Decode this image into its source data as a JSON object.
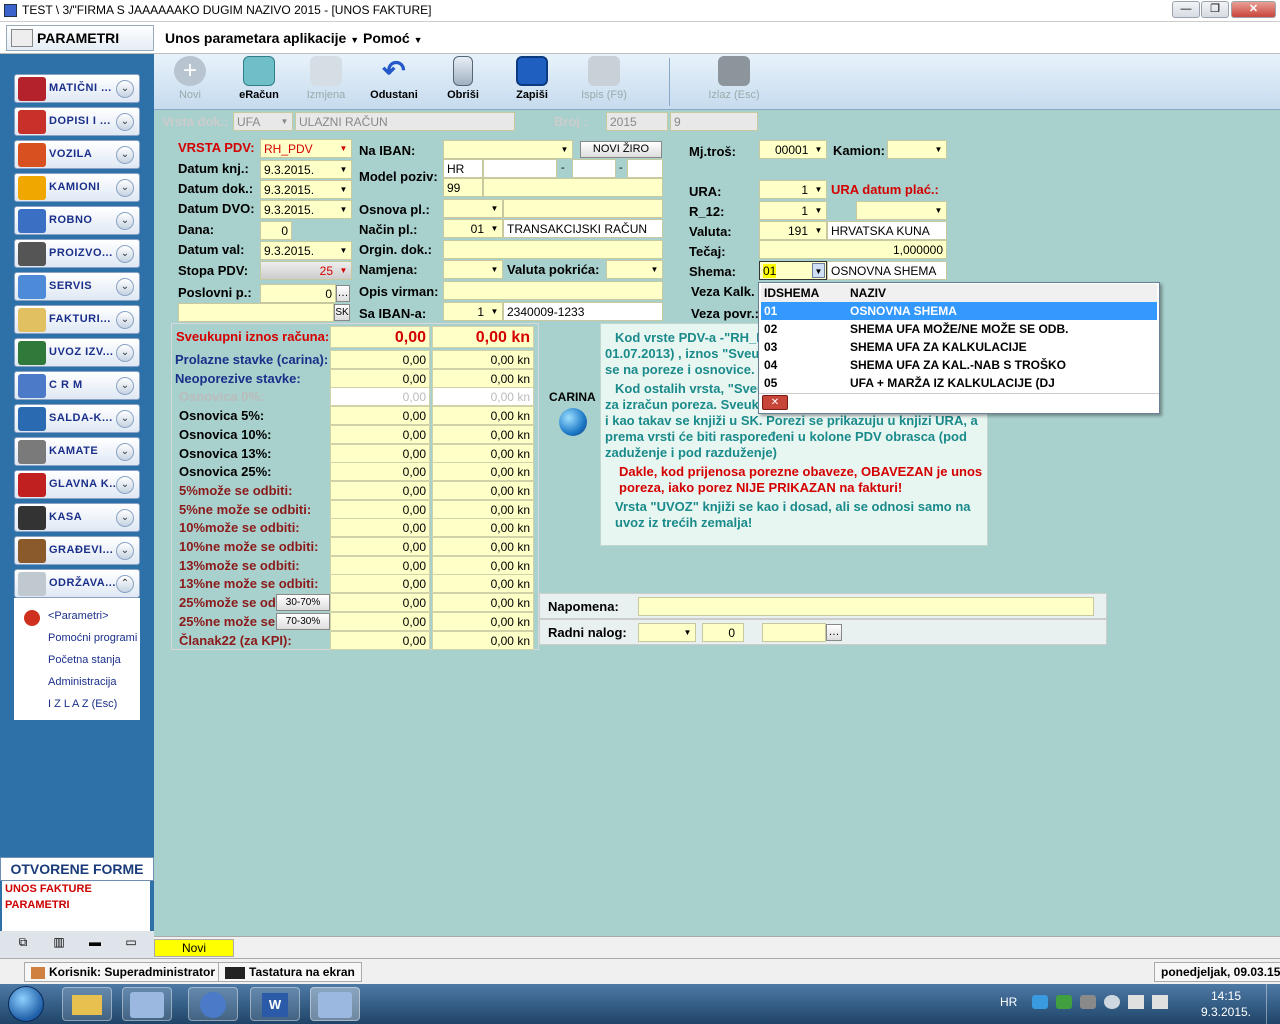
{
  "window": {
    "title": "TEST \\ 3/\"FIRMA S JAAAAAAKO DUGIM NAZIVO  2015 - [UNOS FAKTURE]",
    "min": "—",
    "max": "❐",
    "close": "✕"
  },
  "menubar": {
    "parametri": "PARAMETRI",
    "unos": "Unos parametara aplikacije",
    "pomoc": "Pomoć"
  },
  "sidebar": {
    "items": [
      {
        "label": "MATIČNI ...",
        "color": "#b4232b"
      },
      {
        "label": "DOPISI I ...",
        "color": "#c8302a"
      },
      {
        "label": "VOZILA",
        "color": "#d85020"
      },
      {
        "label": "KAMIONI",
        "color": "#f0a800"
      },
      {
        "label": "ROBNO",
        "color": "#3b6fc4"
      },
      {
        "label": "PROIZVO...",
        "color": "#555555"
      },
      {
        "label": "SERVIS",
        "color": "#4d8ad8"
      },
      {
        "label": "FAKTURI...",
        "color": "#e0c060"
      },
      {
        "label": "UVOZ IZV...",
        "color": "#2f7a3a"
      },
      {
        "label": "C R M",
        "color": "#4d7ac8"
      },
      {
        "label": "SALDA-K...",
        "color": "#2a6ab0"
      },
      {
        "label": "KAMATE",
        "color": "#7a7a7a"
      },
      {
        "label": "GLAVNA K...",
        "color": "#c02020"
      },
      {
        "label": "KASA",
        "color": "#333333"
      },
      {
        "label": "GRAĐEVI...",
        "color": "#8a5a2a"
      },
      {
        "label": "ODRŽAVA...",
        "color": "#c0c8d0"
      }
    ],
    "submenu": [
      "<Parametri>",
      "Pomoćni programi",
      "Početna stanja",
      "Administracija",
      "I Z L A Z (Esc)"
    ],
    "open_forms_title": "OTVORENE FORME",
    "open_forms": [
      "UNOS FAKTURE",
      "PARAMETRI"
    ]
  },
  "toolbar": {
    "novi": "Novi",
    "eracun": "eRačun",
    "izmjena": "Izmjena",
    "odustani": "Odustani",
    "obrisi": "Obriši",
    "zapisi": "Zapiši",
    "ispis": "Ispis (F9)",
    "izlaz": "Izlaz (Esc)"
  },
  "header": {
    "vrsta_dok_label": "Vrsta dok.:",
    "vrsta_dok_code": "UFA",
    "vrsta_dok_name": "ULAZNI RAČUN",
    "broj_label": "Broj :",
    "broj_year": "2015",
    "broj_num": "9"
  },
  "form": {
    "vrsta_pdv_label": "VRSTA PDV:",
    "vrsta_pdv": "RH_PDV",
    "datum_knj_label": "Datum knj.:",
    "datum_knj": "9.3.2015.",
    "datum_dok_label": "Datum dok.:",
    "datum_dok": "9.3.2015.",
    "datum_dvo_label": "Datum DVO:",
    "datum_dvo": "9.3.2015.",
    "dana_label": "Dana:",
    "dana": "0",
    "datum_val_label": "Datum val:",
    "datum_val": "9.3.2015.",
    "stopa_pdv_label": "Stopa PDV:",
    "stopa_pdv": "25",
    "poslovni_p_label": "Poslovni p.:",
    "poslovni_p": "0",
    "sk": "SK",
    "na_iban_label": "Na IBAN:",
    "novi_ziro": "NOVI ŽIRO",
    "model_poziv_label": "Model poziv:",
    "model_hr": "HR",
    "model_99": "99",
    "osnova_pl_label": "Osnova pl.:",
    "nacin_pl_label": "Način pl.:",
    "nacin_pl_code": "01",
    "nacin_pl_name": "TRANSAKCIJSKI RAČUN",
    "orgin_dok_label": "Orgin. dok.:",
    "namjena_label": "Namjena:",
    "valuta_pokrica_label": "Valuta pokrića:",
    "opis_virman_label": "Opis virman:",
    "sa_iban_label": "Sa IBAN-a:",
    "sa_iban_code": "1",
    "sa_iban_value": "2340009-1233",
    "mj_tros_label": "Mj.troš:",
    "mj_tros": "00001",
    "kamion_label": "Kamion:",
    "ura_label": "URA:",
    "ura": "1",
    "ura_datum_label": "URA datum plać.:",
    "r12_label": "R_12:",
    "r12": "1",
    "valuta_label": "Valuta:",
    "valuta_code": "191",
    "valuta_name": "HRVATSKA KUNA",
    "tecaj_label": "Tečaj:",
    "tecaj": "1,000000",
    "shema_label": "Shema:",
    "shema_code": "01",
    "shema_name": "OSNOVNA SHEMA",
    "veza_kalk_label": "Veza Kalk.",
    "veza_povr_label": "Veza povr.:"
  },
  "shema_popup": {
    "col1": "IDSHEMA",
    "col2": "NAZIV",
    "rows": [
      {
        "id": "01",
        "name": "OSNOVNA SHEMA"
      },
      {
        "id": "02",
        "name": "SHEMA UFA MOŽE/NE MOŽE SE ODB."
      },
      {
        "id": "03",
        "name": "SHEMA UFA ZA KALKULACIJE"
      },
      {
        "id": "04",
        "name": "SHEMA UFA ZA KAL.-NAB S TROŠKO"
      },
      {
        "id": "05",
        "name": "UFA + MARŽA IZ KALKULACIJE (DJ"
      }
    ],
    "close": "✕"
  },
  "totals": {
    "header_label": "Sveukupni iznos računa:",
    "header_v1": "0,00",
    "header_v2": "0,00 kn",
    "rows": [
      {
        "label": "Prolazne stavke (carina):",
        "v1": "0,00",
        "v2": "0,00 kn",
        "style": "blue"
      },
      {
        "label": "Neoporezive stavke:",
        "v1": "0,00",
        "v2": "0,00 kn",
        "style": "blue"
      },
      {
        "label": "Osnovica 0%:",
        "v1": "0,00",
        "v2": "0,00 kn",
        "style": "gray"
      },
      {
        "label": "Osnovica 5%:",
        "v1": "0,00",
        "v2": "0,00 kn",
        "style": "black"
      },
      {
        "label": "Osnovica 10%:",
        "v1": "0,00",
        "v2": "0,00 kn",
        "style": "black"
      },
      {
        "label": "Osnovica 13%:",
        "v1": "0,00",
        "v2": "0,00 kn",
        "style": "black"
      },
      {
        "label": "Osnovica 25%:",
        "v1": "0,00",
        "v2": "0,00 kn",
        "style": "black"
      },
      {
        "label": "5%može se odbiti:",
        "v1": "0,00",
        "v2": "0,00 kn",
        "style": "maroon"
      },
      {
        "label": "5%ne može se odbiti:",
        "v1": "0,00",
        "v2": "0,00 kn",
        "style": "maroon"
      },
      {
        "label": "10%može se odbiti:",
        "v1": "0,00",
        "v2": "0,00 kn",
        "style": "maroon"
      },
      {
        "label": "10%ne može se odbiti:",
        "v1": "0,00",
        "v2": "0,00 kn",
        "style": "maroon"
      },
      {
        "label": "13%može se odbiti:",
        "v1": "0,00",
        "v2": "0,00 kn",
        "style": "maroon"
      },
      {
        "label": "13%ne može se odbiti:",
        "v1": "0,00",
        "v2": "0,00 kn",
        "style": "maroon"
      },
      {
        "label": "25%može se od",
        "v1": "0,00",
        "v2": "0,00 kn",
        "style": "maroon",
        "btn": "30-70%"
      },
      {
        "label": "25%ne može se",
        "v1": "0,00",
        "v2": "0,00 kn",
        "style": "maroon",
        "btn": "70-30%"
      },
      {
        "label": "Članak22 (za KPI):",
        "v1": "0,00",
        "v2": "0,00 kn",
        "style": "maroon"
      }
    ]
  },
  "carina": "CARINA",
  "info": {
    "p1": "Kod vrste PDV-a -\"RH_P",
    "p1b": "01.07.2013) , iznos \"Sveu",
    "p1c": "se na poreze i osnovice.",
    "p2": "Kod ostalih vrsta, \"Sveu",
    "p2b": "za izračun poreza. Sveuk",
    "p2c": "i kao takav se knjiži u SK.  Porezi se prikazuju u knjizi URA, a prema vrsti će biti raspoređeni u kolone PDV obrasca (pod zaduženje i pod razduženje)",
    "p3": "Dakle, kod prijenosa porezne obaveze, OBAVEZAN je unos poreza, iako porez NIJE PRIKAZAN na fakturi!",
    "p4": "Vrsta \"UVOZ\" knjiži se kao i dosad, ali se odnosi samo na uvoz iz trećih zemalja!"
  },
  "napomena_label": "Napomena:",
  "radni_nalog_label": "Radni nalog:",
  "radni_nalog_val": "0",
  "status": {
    "mode": "Novi"
  },
  "appstatus": {
    "user": "Korisnik: Superadministrator",
    "keyboard": "Tastatura na ekran",
    "date": "ponedjeljak, 09.03.15"
  },
  "taskbar": {
    "lang": "HR",
    "time": "14:15",
    "date": "9.3.2015."
  }
}
